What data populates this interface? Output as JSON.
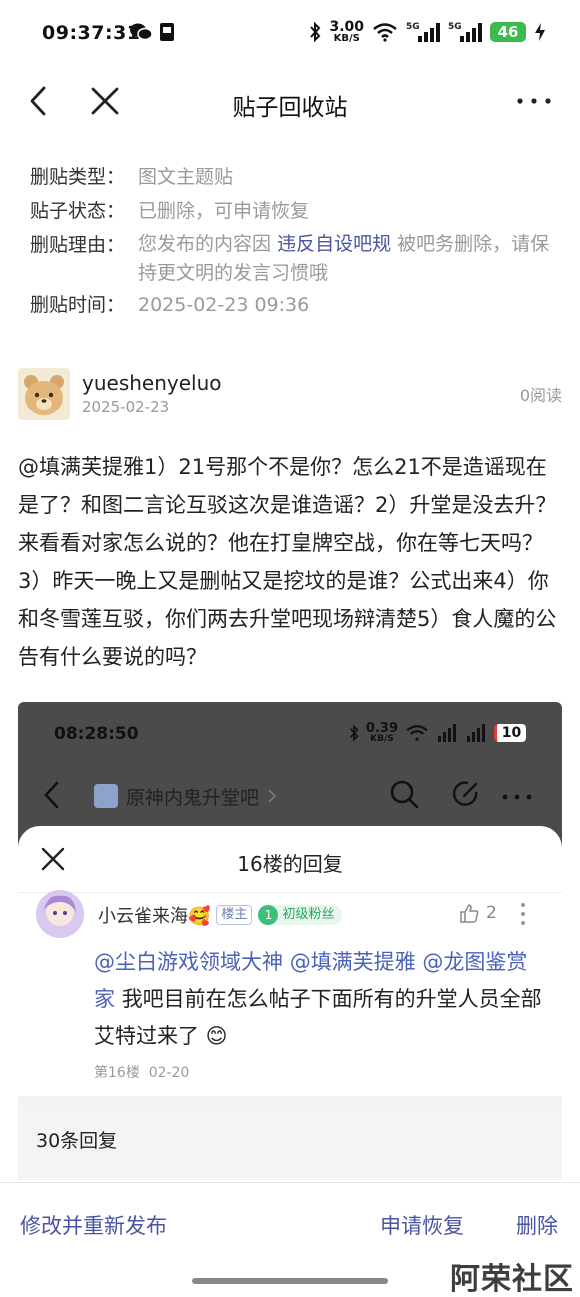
{
  "status_bar": {
    "time": "09:37:31",
    "speed_value": "3.00",
    "speed_unit": "KB/S",
    "battery": "46",
    "signal_labels": [
      "5G",
      "5G"
    ]
  },
  "nav": {
    "title": "贴子回收站"
  },
  "info": {
    "type_label": "删贴类型：",
    "type_value": "图文主题贴",
    "status_label": "贴子状态：",
    "status_value": "已删除，可申请恢复",
    "reason_label": "删贴理由：",
    "reason_prefix": "您发布的内容因",
    "reason_link": "违反自设吧规",
    "reason_suffix": "被吧务删除，请保持更文明的发言习惯哦",
    "time_label": "删贴时间：",
    "time_value": "2025-02-23 09:36"
  },
  "author": {
    "name": "yueshenyeluo",
    "date": "2025-02-23",
    "reads": "0阅读"
  },
  "post": {
    "body": "@填满芙提雅1）21号那个不是你？怎么21不是造谣现在是了？和图二言论互驳这次是谁造谣？2）升堂是没去升？来看看对家怎么说的？他在打皇牌空战，你在等七天吗？3）昨天一晚上又是删帖又是挖坟的是谁？公式出来4）你和冬雪莲互驳，你们两去升堂吧现场辩清楚5）食人魔的公告有什么要说的吗？"
  },
  "embed": {
    "time": "08:28:50",
    "speed_value": "0.39",
    "speed_unit": "KB/S",
    "battery": "10",
    "forum_name": "原神内鬼升堂吧",
    "sheet_title": "16楼的回复",
    "reply": {
      "user": "小云雀来海🥰",
      "owner_badge": "楼主",
      "level_num": "1",
      "level_label": "初级粉丝",
      "likes": "2",
      "mention1": "@尘白游戏领域大神",
      "mention2": "@填满芙提雅",
      "mention3": "@龙图鉴赏家",
      "text": "我吧目前在怎么帖子下面所有的升堂人员全部艾特过来了 😊",
      "floor": "第16楼",
      "date": "02-20"
    },
    "reply_count": "30条回复"
  },
  "actions": {
    "edit_repost": "修改并重新发布",
    "restore": "申请恢复",
    "delete": "删除"
  },
  "watermark": "阿荣社区"
}
